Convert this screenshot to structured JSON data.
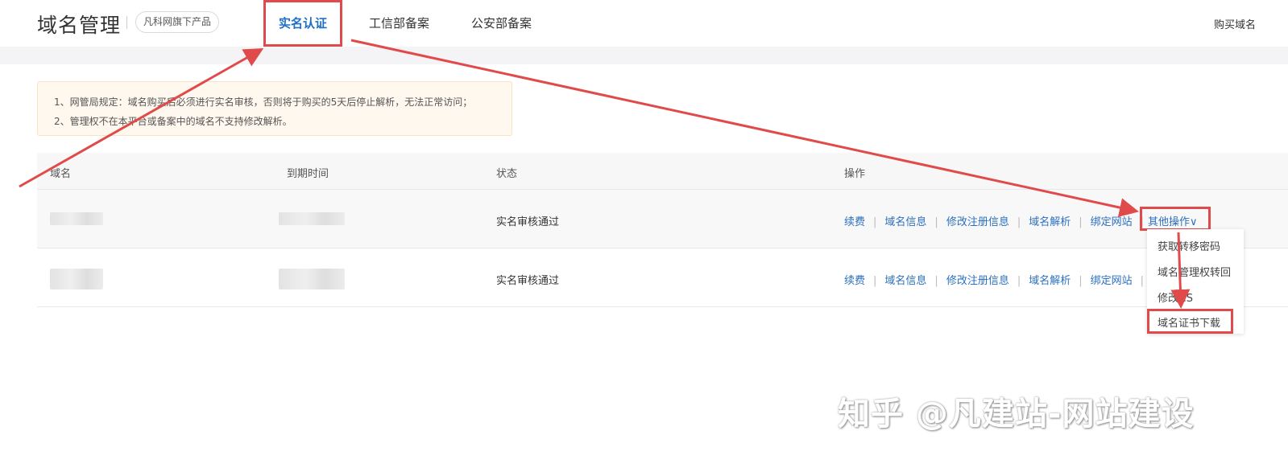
{
  "header": {
    "title": "域名管理",
    "badge": "凡科网旗下产品",
    "tabs": [
      {
        "label": "实名认证"
      },
      {
        "label": "工信部备案"
      },
      {
        "label": "公安部备案"
      }
    ],
    "buy_link": "购买域名"
  },
  "notice": {
    "line1": "1、网管局规定：域名购买后必须进行实名审核，否则将于购买的5天后停止解析，无法正常访问；",
    "line2": "2、管理权不在本平台或备案中的域名不支持修改解析。"
  },
  "table": {
    "headers": [
      "域名",
      "到期时间",
      "状态",
      "操作"
    ],
    "rows": [
      {
        "status": "实名审核通过",
        "ops": [
          "续费",
          "域名信息",
          "修改注册信息",
          "域名解析",
          "绑定网站"
        ],
        "more": "其他操作∨"
      },
      {
        "status": "实名审核通过",
        "ops": [
          "续费",
          "域名信息",
          "修改注册信息",
          "域名解析",
          "绑定网站"
        ]
      }
    ]
  },
  "dropdown": {
    "items": [
      "获取转移密码",
      "域名管理权转回",
      "修改NS",
      "域名证书下载"
    ]
  },
  "watermark": "知乎 @凡建站-网站建设",
  "colors": {
    "accent": "#1e6fc7",
    "annotation": "#e14a4a",
    "notice_bg": "#fff8ee"
  }
}
